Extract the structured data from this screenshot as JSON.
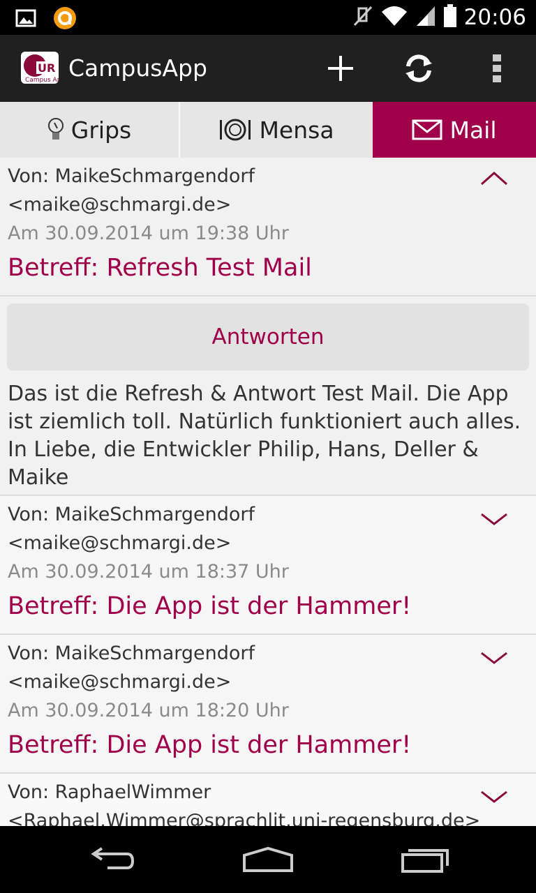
{
  "status_bar": {
    "time": "20:06",
    "icons": [
      "image-notification-icon",
      "app-notification-icon",
      "mute-icon",
      "wifi-icon",
      "signal-icon",
      "battery-icon"
    ]
  },
  "action_bar": {
    "title": "CampusApp",
    "logo_text": "UR",
    "logo_subtext": "Campus App",
    "actions": [
      "add-icon",
      "refresh-icon",
      "overflow-menu-icon"
    ]
  },
  "tabs": [
    {
      "label": "Grips",
      "icon": "lightbulb-icon",
      "selected": false
    },
    {
      "label": "Mensa",
      "icon": "plate-icon",
      "selected": false
    },
    {
      "label": "Mail",
      "icon": "envelope-icon",
      "selected": true
    }
  ],
  "mails": [
    {
      "from": "Von: MaikeSchmargendorf",
      "address": "<maike@schmargi.de>",
      "date": "Am 30.09.2014 um 19:38 Uhr",
      "subject": "Betreff: Refresh Test Mail",
      "expanded": true,
      "reply_label": "Antworten",
      "body": "Das ist die Refresh & Antwort Test Mail. Die App ist ziemlich toll. Natürlich funktioniert auch alles. In Liebe, die Entwickler Philip, Hans, Deller & Maike"
    },
    {
      "from": "Von: MaikeSchmargendorf",
      "address": "<maike@schmargi.de>",
      "date": "Am 30.09.2014 um 18:37 Uhr",
      "subject": "Betreff: Die App ist der Hammer!",
      "expanded": false
    },
    {
      "from": "Von: MaikeSchmargendorf",
      "address": "<maike@schmargi.de>",
      "date": "Am 30.09.2014 um 18:20 Uhr",
      "subject": "Betreff: Die App ist der Hammer!",
      "expanded": false
    },
    {
      "from": "Von: RaphaelWimmer",
      "address": "<Raphael.Wimmer@sprachlit.uni-regensburg.de>",
      "expanded": false
    }
  ],
  "nav_bar": [
    "back-icon",
    "home-icon",
    "recent-apps-icon"
  ],
  "colors": {
    "accent": "#a0004a",
    "action_bar": "#202020",
    "tab_bg": "#e6e6e6",
    "list_bg": "#f1f1f1"
  }
}
